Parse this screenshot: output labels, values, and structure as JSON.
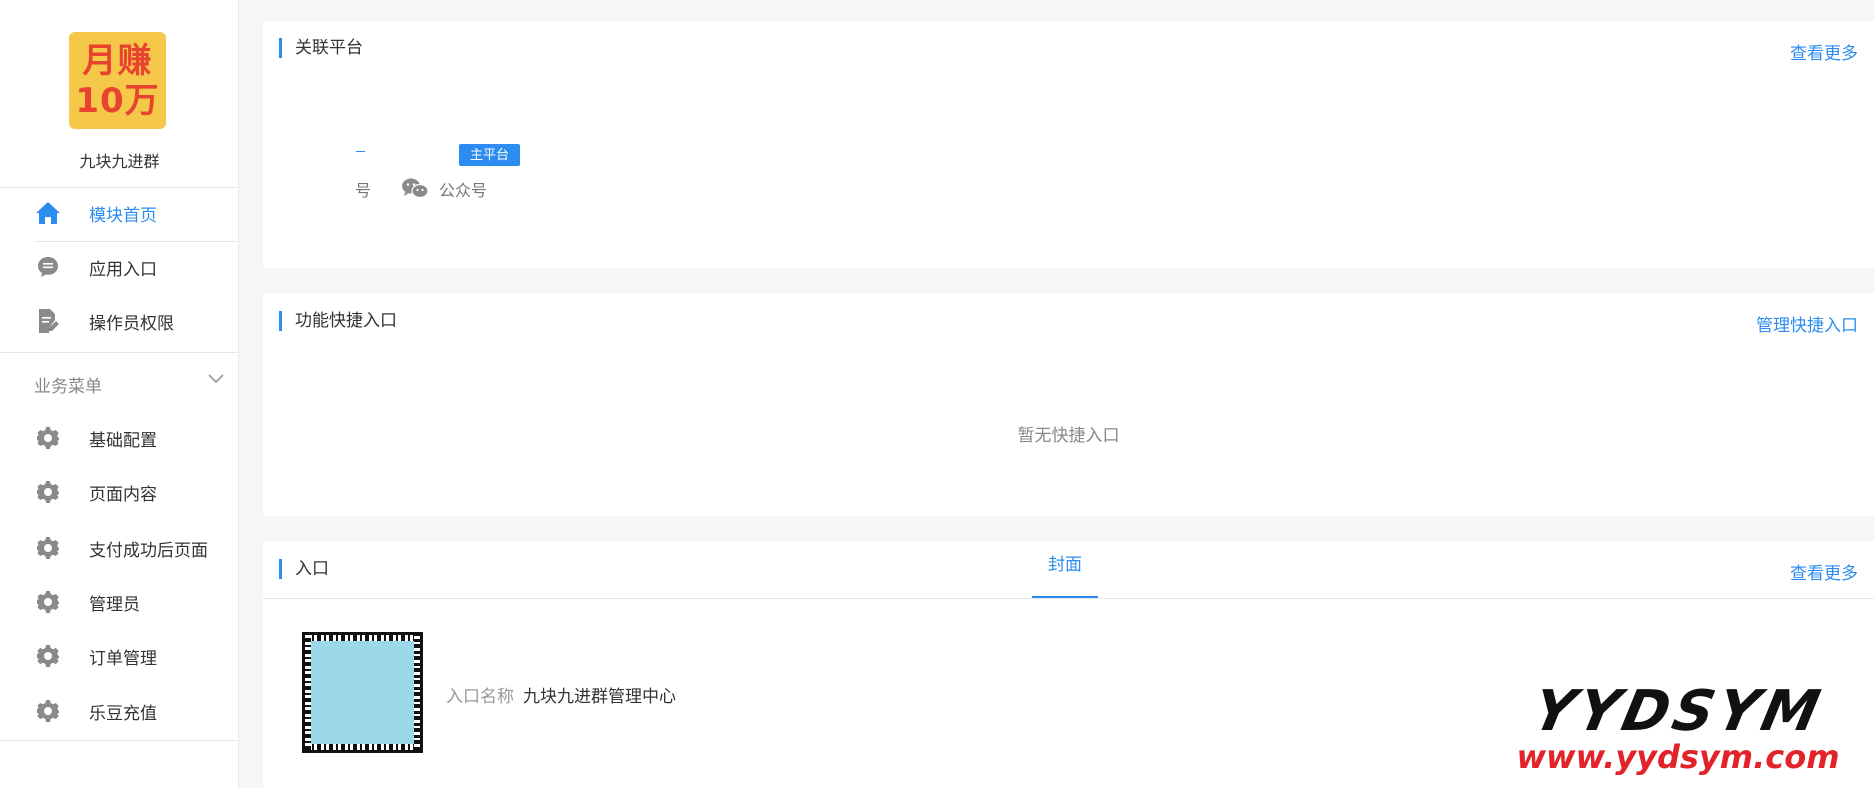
{
  "sidebar": {
    "logo_lines": [
      "月赚",
      "10万"
    ],
    "app_name": "九块九进群",
    "items": [
      {
        "label": "模块首页",
        "icon": "home-icon",
        "active": true
      },
      {
        "label": "应用入口",
        "icon": "chat-bubble-icon",
        "active": false
      },
      {
        "label": "操作员权限",
        "icon": "document-edit-icon",
        "active": false
      }
    ],
    "section": {
      "label": "业务菜单",
      "icon": "chevron-down-icon"
    },
    "business_items": [
      {
        "label": "基础配置",
        "icon": "gear-icon"
      },
      {
        "label": "页面内容",
        "icon": "gear-icon"
      },
      {
        "label": "支付成功后页面",
        "icon": "gear-icon"
      },
      {
        "label": "管理员",
        "icon": "gear-icon"
      },
      {
        "label": "订单管理",
        "icon": "gear-icon"
      },
      {
        "label": "乐豆充值",
        "icon": "gear-icon"
      }
    ]
  },
  "linked_platform": {
    "title": "关联平台",
    "more_link": "查看更多",
    "badge": "主平台",
    "partial_text": "号",
    "platform_icon": "wechat-icon",
    "platform_name": "公众号"
  },
  "shortcuts": {
    "title": "功能快捷入口",
    "manage_link": "管理快捷入口",
    "empty_text": "暂无快捷入口"
  },
  "entry": {
    "title": "入口",
    "tab": "封面",
    "more_link": "查看更多",
    "name_label": "入口名称",
    "name_value": "九块九进群管理中心"
  },
  "watermark": {
    "main": "YYDSYM",
    "url": "www.yydsym.com"
  },
  "colors": {
    "accent": "#2d8cf0",
    "background": "#f5f6f8",
    "logo_bg": "#f5c84a",
    "logo_text": "#e8432f",
    "watermark_red": "#e2242a"
  }
}
